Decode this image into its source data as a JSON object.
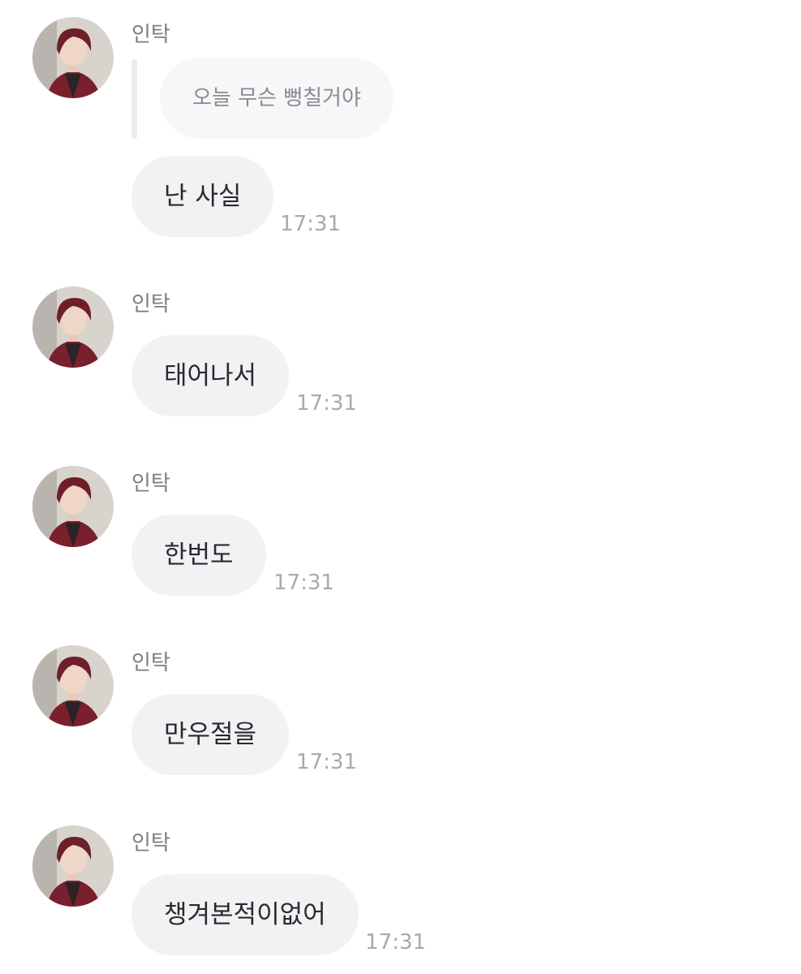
{
  "messages": [
    {
      "sender": "인탁",
      "reply_quote": "오늘 무슨 뻥칠거야",
      "text": "난 사실",
      "time": "17:31"
    },
    {
      "sender": "인탁",
      "text": "태어나서",
      "time": "17:31"
    },
    {
      "sender": "인탁",
      "text": "한번도",
      "time": "17:31"
    },
    {
      "sender": "인탁",
      "text": "만우절을",
      "time": "17:31"
    },
    {
      "sender": "인탁",
      "text": "챙겨본적이없어",
      "time": "17:31"
    }
  ]
}
